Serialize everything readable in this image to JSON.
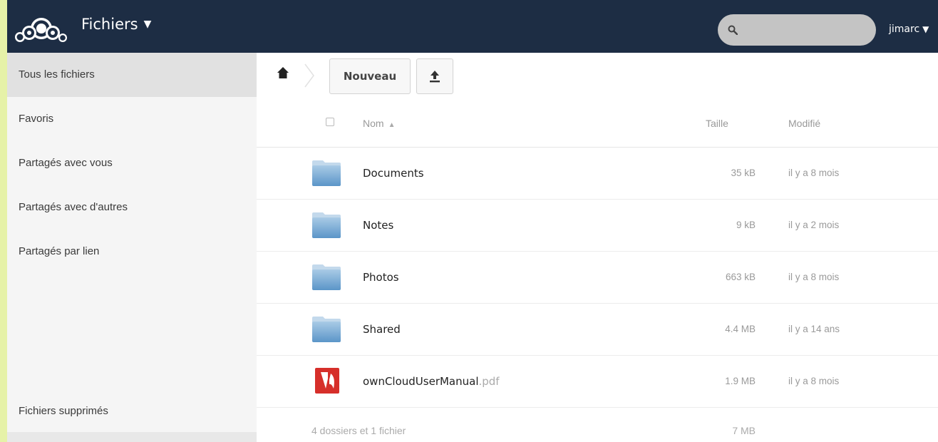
{
  "header": {
    "app_name": "Fichiers",
    "app_caret": "▼",
    "search_placeholder": "",
    "user": "jimarc",
    "user_caret": "▼",
    "bg_color": "#1d2d44"
  },
  "sidebar": {
    "items": [
      {
        "label": "Tous les fichiers",
        "active": true
      },
      {
        "label": "Favoris"
      },
      {
        "label": "Partagés avec vous"
      },
      {
        "label": "Partagés avec d'autres"
      },
      {
        "label": "Partagés par lien"
      }
    ],
    "trash": "Fichiers supprimés"
  },
  "controls": {
    "new_label": "Nouveau",
    "upload_icon": "upload-icon",
    "home_icon": "home-icon"
  },
  "table": {
    "columns": {
      "name": "Nom",
      "sort": "▲",
      "size": "Taille",
      "modified": "Modifié"
    },
    "rows": [
      {
        "name": "Documents",
        "ext": "",
        "size": "35 kB",
        "modified": "il y a 8 mois",
        "icon": "folder-icon"
      },
      {
        "name": "Notes",
        "ext": "",
        "size": "9 kB",
        "modified": "il y a 2 mois",
        "icon": "folder-icon"
      },
      {
        "name": "Photos",
        "ext": "",
        "size": "663 kB",
        "modified": "il y a 8 mois",
        "icon": "folder-icon"
      },
      {
        "name": "Shared",
        "ext": "",
        "size": "4.4 MB",
        "modified": "il y a 14 ans",
        "icon": "folder-icon"
      },
      {
        "name": "ownCloudUserManual",
        "ext": ".pdf",
        "size": "1.9 MB",
        "modified": "il y a 8 mois",
        "icon": "pdf-icon"
      }
    ],
    "summary": {
      "text": "4 dossiers et 1 fichier",
      "size": "7 MB"
    }
  }
}
